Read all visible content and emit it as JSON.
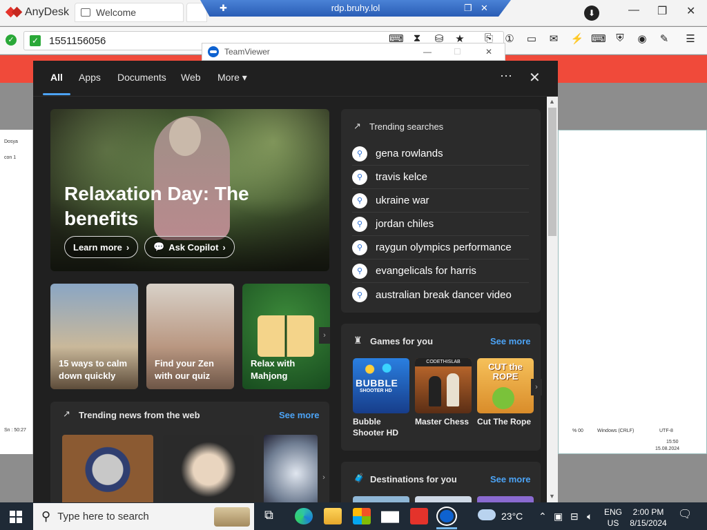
{
  "anydesk": {
    "app_name": "AnyDesk",
    "tab_label": "Welcome",
    "remote_host": "rdp.bruhy.lol",
    "address": "1551156056"
  },
  "teamviewer": {
    "title": "TeamViewer"
  },
  "left_doc": {
    "menu": "Dosya",
    "line1": "con 1 ",
    "status": "Sn : 50:27"
  },
  "right_doc": {
    "status1": "% 00",
    "status2": "Windows (CRLF)",
    "status3": "UTF-8",
    "time": "15:50",
    "date": "15.08.2024"
  },
  "nav": {
    "tabs": [
      "All",
      "Apps",
      "Documents",
      "Web",
      "More"
    ],
    "more_caret": "▾"
  },
  "hero": {
    "title": "Relaxation Day: The benefits",
    "learn_more": "Learn more",
    "ask_copilot": "Ask Copilot"
  },
  "cards": [
    {
      "caption": "15 ways to calm down quickly"
    },
    {
      "caption": "Find your Zen with our quiz"
    },
    {
      "caption": "Relax with Mahjong"
    }
  ],
  "trending_searches": {
    "title": "Trending searches",
    "items": [
      "gena rowlands",
      "travis kelce",
      "ukraine war",
      "jordan chiles",
      "raygun olympics performance",
      "evangelicals for harris",
      "australian break dancer video"
    ]
  },
  "trending_news": {
    "title": "Trending news from the web",
    "see_more": "See more"
  },
  "games": {
    "title": "Games for you",
    "see_more": "See more",
    "items": [
      "Bubble Shooter HD",
      "Master Chess",
      "Cut The Rope"
    ],
    "tile_text": [
      "BUBBLE",
      "SHOOTER HD",
      "CODETHISLAB",
      "CUT the ROPE"
    ]
  },
  "destinations": {
    "title": "Destinations for you",
    "see_more": "See more"
  },
  "taskbar": {
    "search_placeholder": "Type here to search",
    "weather": "23°C",
    "lang1": "ENG",
    "lang2": "US",
    "time": "2:00 PM",
    "date": "8/15/2024"
  },
  "colors": {
    "accent": "#4ca3f5",
    "anydesk_red": "#e4332b",
    "panel_bg": "#202020"
  }
}
